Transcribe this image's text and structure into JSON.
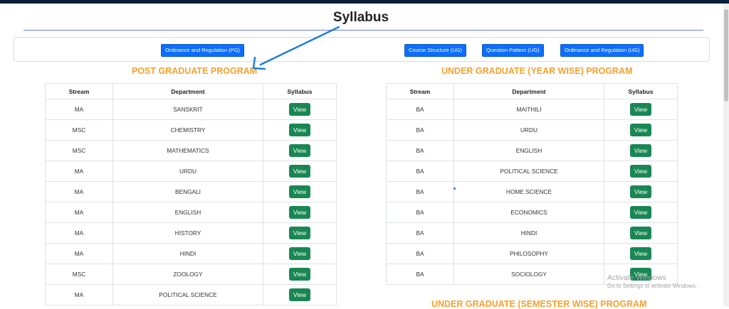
{
  "page": {
    "title": "Syllabus"
  },
  "buttons": {
    "pg_ordinance": "Ordinance and Regulation (PG)",
    "ug_course_structure": "Course Structure (UG)",
    "ug_question_pattern": "Question Pattern (UG)",
    "ug_ordinance": "Ordinance and Regulation (UG)"
  },
  "pg": {
    "title": "POST GRADUATE PROGRAM",
    "headers": {
      "stream": "Stream",
      "department": "Department",
      "syllabus": "Syllabus"
    },
    "rows": [
      {
        "stream": "MA",
        "department": "SANSKRIT",
        "action": "View"
      },
      {
        "stream": "MSC",
        "department": "CHEMISTRY",
        "action": "View"
      },
      {
        "stream": "MSC",
        "department": "MATHEMATICS",
        "action": "View"
      },
      {
        "stream": "MA",
        "department": "URDU",
        "action": "View"
      },
      {
        "stream": "MA",
        "department": "BENGALI",
        "action": "View"
      },
      {
        "stream": "MA",
        "department": "ENGLISH",
        "action": "View"
      },
      {
        "stream": "MA",
        "department": "HISTORY",
        "action": "View"
      },
      {
        "stream": "MA",
        "department": "HINDI",
        "action": "View"
      },
      {
        "stream": "MSC",
        "department": "ZOOLOGY",
        "action": "View"
      },
      {
        "stream": "MA",
        "department": "POLITICAL SCIENCE",
        "action": "View"
      }
    ]
  },
  "ug_year": {
    "title": "UNDER GRADUATE (YEAR WISE) PROGRAM",
    "headers": {
      "stream": "Stream",
      "department": "Department",
      "syllabus": "Syllabus"
    },
    "rows": [
      {
        "stream": "BA",
        "department": "MAITHILI",
        "action": "View"
      },
      {
        "stream": "BA",
        "department": "URDU",
        "action": "View"
      },
      {
        "stream": "BA",
        "department": "ENGLISH",
        "action": "View"
      },
      {
        "stream": "BA",
        "department": "POLITICAL SCIENCE",
        "action": "View"
      },
      {
        "stream": "BA",
        "department": "HOME SCIENCE",
        "action": "View"
      },
      {
        "stream": "BA",
        "department": "ECONOMICS",
        "action": "View"
      },
      {
        "stream": "BA",
        "department": "HINDI",
        "action": "View"
      },
      {
        "stream": "BA",
        "department": "PHILOSOPHY",
        "action": "View"
      },
      {
        "stream": "BA",
        "department": "SOCIOLOGY",
        "action": "View"
      }
    ]
  },
  "ug_semester": {
    "title": "UNDER GRADUATE (SEMESTER WISE) PROGRAM"
  },
  "watermark": {
    "line1": "Activate Windows",
    "line2": "Go to Settings to activate Windows."
  },
  "colors": {
    "section_title": "#f7a12d",
    "primary_button": "#0d6efd",
    "view_button": "#198754",
    "annotation_arrow": "#1f7fd1"
  }
}
